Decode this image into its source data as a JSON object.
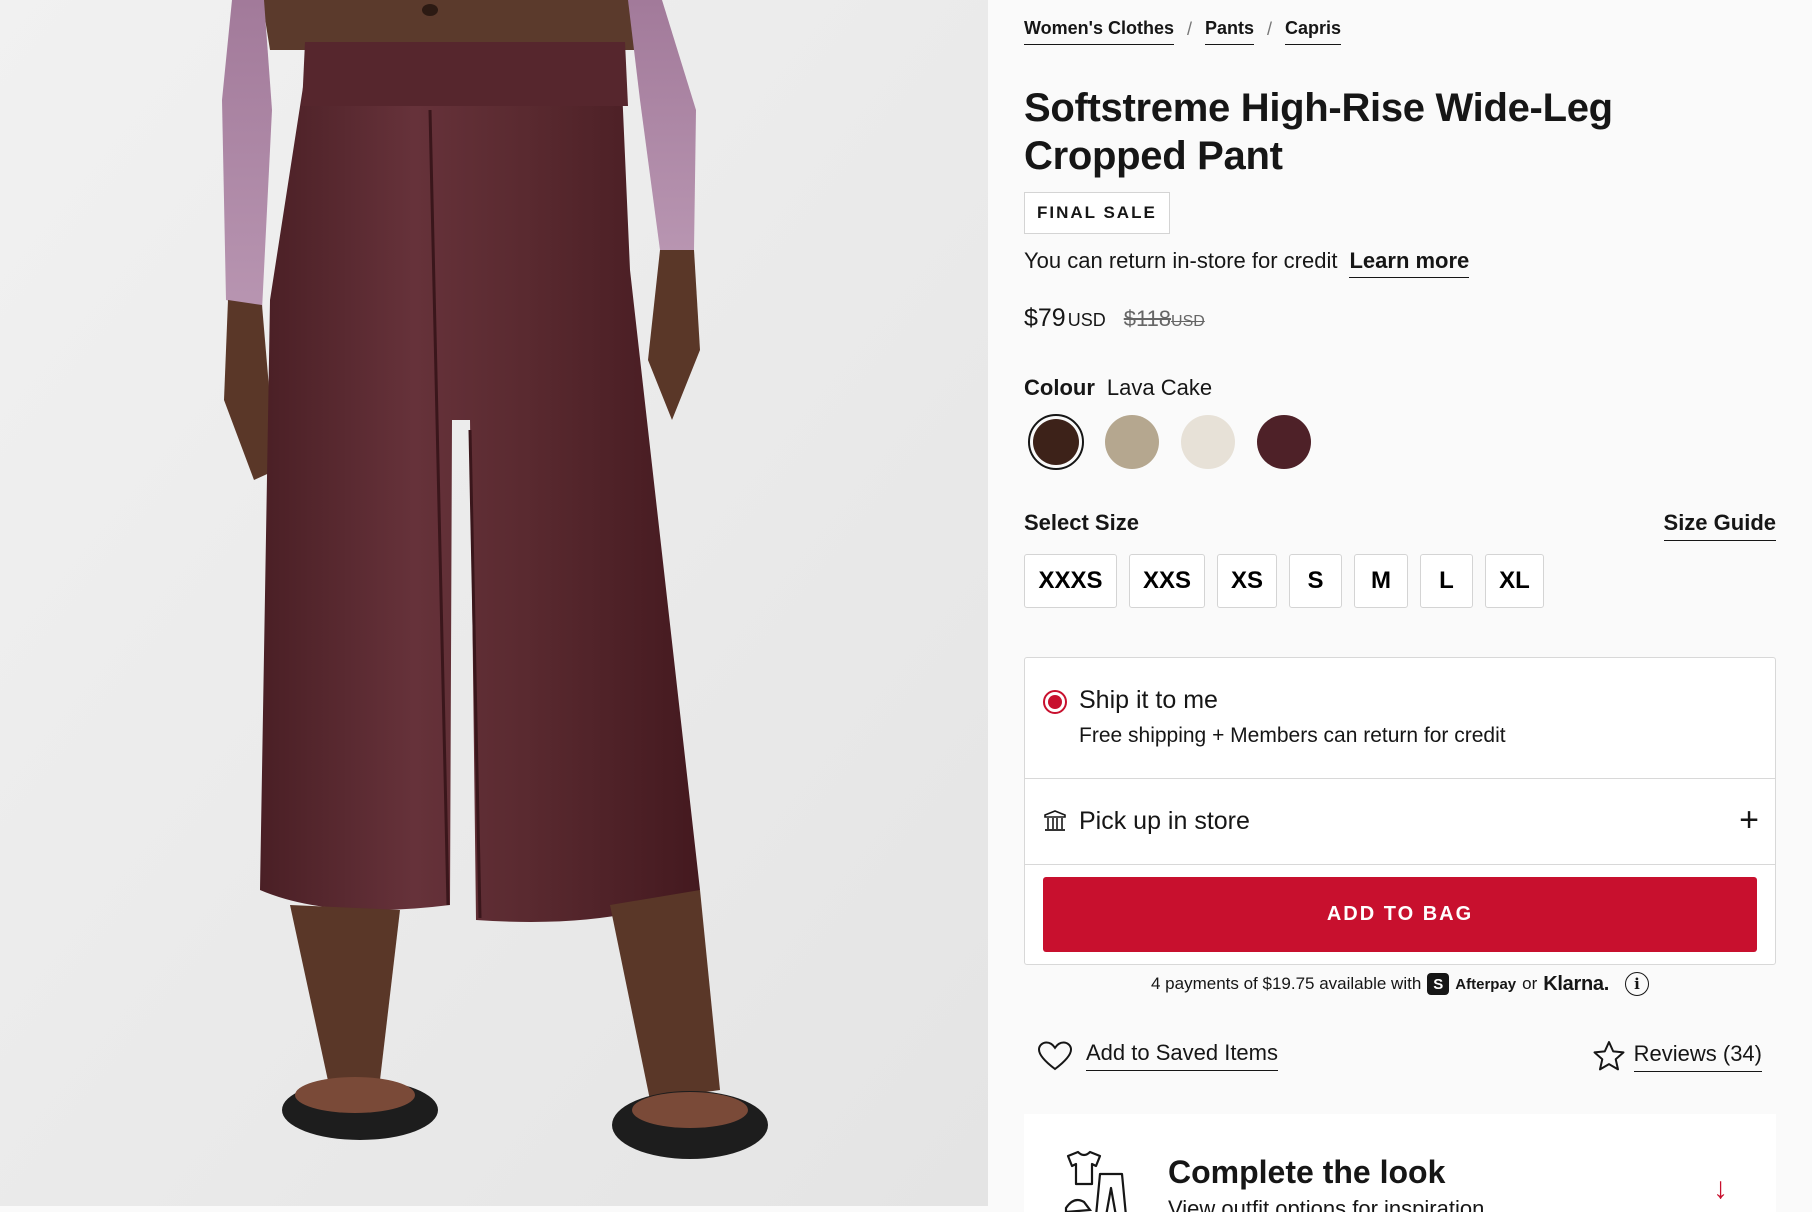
{
  "breadcrumb": [
    "Women's Clothes",
    "Pants",
    "Capris"
  ],
  "breadcrumb_separator": "/",
  "product": {
    "title": "Softstreme High-Rise Wide-Leg Cropped Pant",
    "badge": "FINAL SALE",
    "return_text": "You can return in-store for credit",
    "learn_more": "Learn more",
    "price": "$79",
    "price_currency": "USD",
    "original_price": "$118",
    "original_currency": "USD"
  },
  "colour": {
    "label": "Colour",
    "selected": "Lava Cake",
    "swatches": [
      "#3d2219",
      "#b5a78f",
      "#e7e1d7",
      "#4e2128"
    ]
  },
  "size": {
    "label": "Select Size",
    "guide": "Size Guide",
    "options": [
      "XXXS",
      "XXS",
      "XS",
      "S",
      "M",
      "L",
      "XL"
    ]
  },
  "delivery": {
    "ship_title": "Ship it to me",
    "ship_sub": "Free shipping + Members can return for credit",
    "pickup": "Pick up in store",
    "plus": "+",
    "add_to_bag": "ADD TO BAG"
  },
  "payment": {
    "text": "4 payments of $19.75 available with",
    "afterpay_mark": "S",
    "afterpay": "Afterpay",
    "or": "or",
    "klarna": "Klarna.",
    "info": "i"
  },
  "actions": {
    "saved": "Add to Saved Items",
    "reviews": "Reviews (34)"
  },
  "complete_look": {
    "title": "Complete the look",
    "subtitle": "View outfit options for inspiration",
    "arrow": "↓"
  },
  "colors": {
    "accent": "#c8102e",
    "text": "#161616",
    "pant": "#5a2a2f"
  }
}
